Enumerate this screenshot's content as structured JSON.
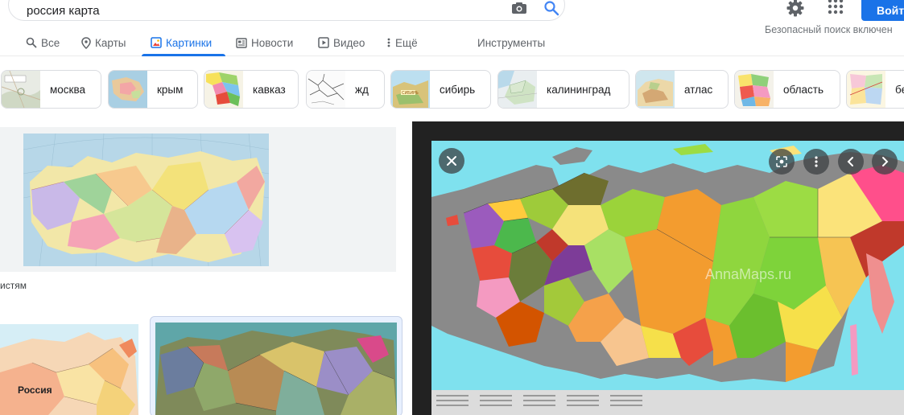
{
  "search": {
    "query": "россия карта"
  },
  "header": {
    "signin_label": "Войти"
  },
  "tabs": [
    {
      "label": "Все",
      "icon": "search-icon"
    },
    {
      "label": "Карты",
      "icon": "map-pin-icon"
    },
    {
      "label": "Картинки",
      "icon": "image-icon",
      "active": true
    },
    {
      "label": "Новости",
      "icon": "news-icon"
    },
    {
      "label": "Видео",
      "icon": "video-icon"
    },
    {
      "label": "Ещё",
      "icon": "more-vert-icon"
    }
  ],
  "tools_label": "Инструменты",
  "safe_search": "Безопасный поиск включен",
  "chips": [
    {
      "label": "москва"
    },
    {
      "label": "крым"
    },
    {
      "label": "кавказ"
    },
    {
      "label": "жд"
    },
    {
      "label": "сибирь"
    },
    {
      "label": "калининград"
    },
    {
      "label": "атлас"
    },
    {
      "label": "область"
    },
    {
      "label": "бе"
    }
  ],
  "results": [
    {
      "caption": "истям"
    },
    {
      "map_label": "Россия"
    }
  ],
  "preview": {
    "watermark": "AnnaMaps.ru"
  },
  "colors": {
    "accent": "#1a73e8",
    "preview_bg": "#222222",
    "sea": "#7fe1ee"
  }
}
